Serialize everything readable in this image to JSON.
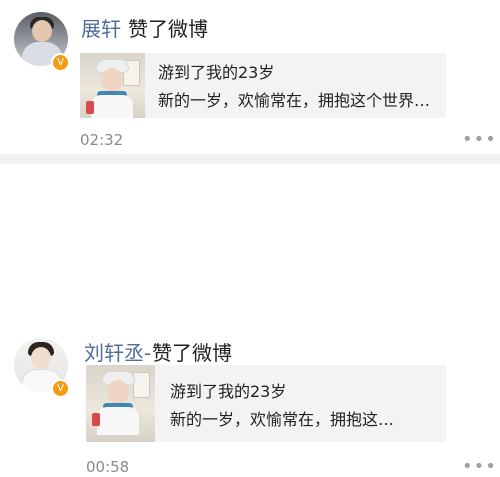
{
  "feed": {
    "items": [
      {
        "username": "展轩",
        "action": "赞了微博",
        "card": {
          "line1": "游到了我的23岁",
          "line2": "新的一岁，欢愉常在，拥抱这个世界…"
        },
        "time": "02:32",
        "verified": true,
        "more_icon": "more-horizontal-icon"
      },
      {
        "username": "刘轩丞-",
        "action": "赞了微博",
        "card": {
          "line1": "游到了我的23岁",
          "line2": "新的一岁，欢愉常在，拥抱这…"
        },
        "time": "00:58",
        "verified": true,
        "more_icon": "more-horizontal-icon"
      }
    ]
  },
  "colors": {
    "username": "#4f6d9b",
    "badge": "#f39c12",
    "card_background": "#f3f3f3",
    "separator": "#f2f2f2"
  }
}
